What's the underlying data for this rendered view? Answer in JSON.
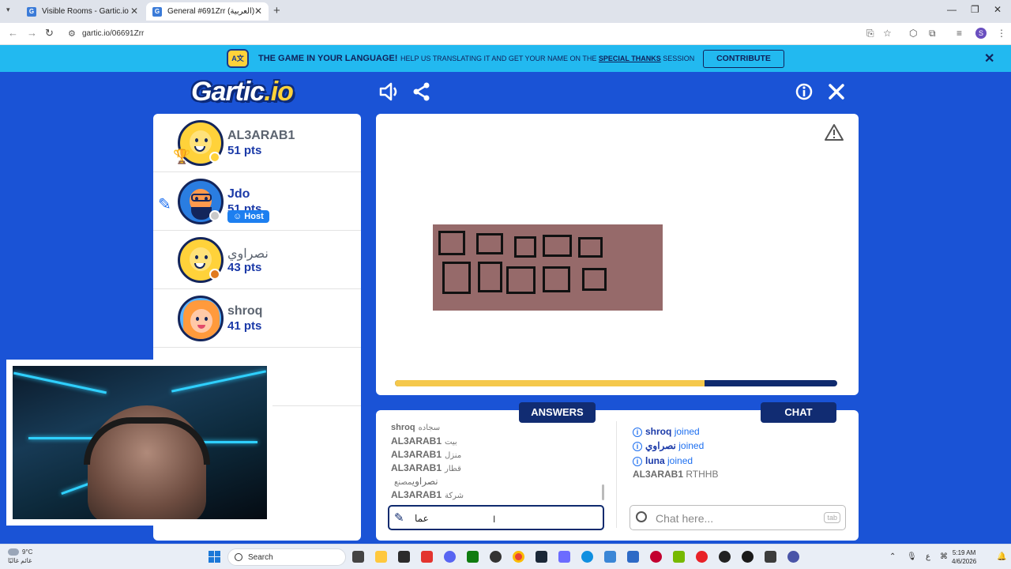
{
  "browser": {
    "tabs": [
      {
        "title": "Visible Rooms - Gartic.io",
        "active": false
      },
      {
        "title": "General #691Zrr (العربية) - Gartic",
        "active": true
      }
    ],
    "url": "gartic.io/06691Zrr"
  },
  "banner": {
    "headline": "THE GAME IN YOUR LANGUAGE!",
    "text_before": "HELP US TRANSLATING IT AND GET YOUR NAME ON THE",
    "link": "SPECIAL THANKS",
    "text_after": "SESSION",
    "contribute_label": "CONTRIBUTE"
  },
  "game": {
    "logo_main": "Gartic",
    "logo_suffix": ".io",
    "players": [
      {
        "name": "AL3ARAB1",
        "points": "51 pts",
        "face_color": "#ffd23a",
        "status_color": "#ffd23a",
        "trophy": true
      },
      {
        "name": "Jdo",
        "points": "51 pts",
        "face_color": "#ff9a4d",
        "status_color": "#c9c9c9",
        "host_label": "Host",
        "drawing": true
      },
      {
        "name": "نصراوي",
        "points": "43 pts",
        "face_color": "#ffd23a",
        "status_color": "#e07a1f"
      },
      {
        "name": "shroq",
        "points": "41 pts",
        "face_color": "#ffc9a8",
        "status_color": null
      }
    ],
    "progress_fraction": 0.7,
    "drawing_color": "#966a6a"
  },
  "answers": {
    "tab_label": "ANSWERS",
    "items": [
      {
        "user": "shroq",
        "word": "سجاده"
      },
      {
        "user": "AL3ARAB1",
        "word": "بيت"
      },
      {
        "user": "AL3ARAB1",
        "word": "منزل"
      },
      {
        "user": "AL3ARAB1",
        "word": "قطار"
      },
      {
        "user": "نصراوي",
        "word": "مصنع"
      },
      {
        "user": "AL3ARAB1",
        "word": "شركة"
      }
    ],
    "input_value": "عما"
  },
  "chat": {
    "tab_label": "CHAT",
    "joined": [
      {
        "user": "shroq",
        "action": "joined"
      },
      {
        "user": "نصراوي",
        "action": "joined"
      },
      {
        "user": "luna",
        "action": "joined"
      }
    ],
    "message": {
      "user": "AL3ARAB1",
      "text": "RTHHB"
    },
    "placeholder": "Chat here...",
    "tab_key": "tab"
  },
  "taskbar": {
    "weather_temp": "9°C",
    "weather_desc": "غائم غالبًا",
    "search_label": "Search",
    "lang": "ع",
    "time": "5:19 AM",
    "date": "4/6/2026"
  }
}
